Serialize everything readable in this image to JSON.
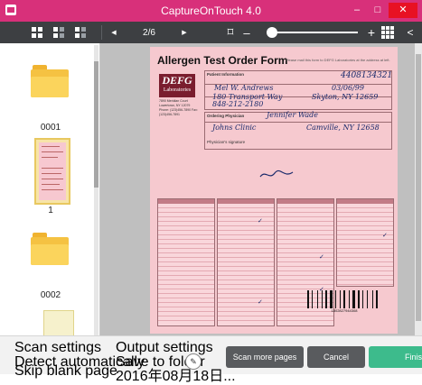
{
  "window": {
    "title": "CaptureOnTouch 4.0",
    "controls": {
      "minimize": "–",
      "maximize": "□",
      "close": "✕"
    }
  },
  "toolbar": {
    "page_indicator": "2/6",
    "prev_icon": "◀",
    "next_icon": "▶",
    "fit_icon": "⌑",
    "zoom_out": "–",
    "zoom_in": "+",
    "collapse_icon": "<",
    "zoom_level_fraction": 0.05
  },
  "thumbnails": [
    {
      "label": "0001",
      "kind": "folder"
    },
    {
      "label": "1",
      "kind": "page",
      "selected": true
    },
    {
      "label": "0002",
      "kind": "folder"
    }
  ],
  "document": {
    "title": "Allergen Test Order Form",
    "note": "Please mail this form to DEFG Laboratories at the address at left.",
    "logo_line1": "DEFG",
    "logo_line2": "Laboratories",
    "address": "7890 Meridian Court Lowertown, NY 12079 Phone: (123)456-7890 Fax: (123)456-7891",
    "patient_info_label": "Patient Information",
    "ordering_physician_label": "Ordering Physician",
    "physician_signature_label": "Physician's signature",
    "handwriting": {
      "id": "4408134321",
      "name": "Mel W. Andrews",
      "dob": "03/06/99",
      "address": "180 Transport Way",
      "city": "Skyton, NY 12659",
      "phone": "848-212-2180",
      "physician": "Jennifer Wade",
      "clinic": "Johns Clinic",
      "phys_city": "Camville, NY 12658"
    },
    "barcode_number": "1802827944308"
  },
  "bottom": {
    "scan_settings_label": "Scan settings",
    "scan_setting_1": "Detect automatically",
    "scan_setting_2": "Skip blank page",
    "output_settings_label": "Output settings",
    "output_setting_1": "Save to folder",
    "output_setting_2": "2016年08月18日...",
    "edit_icon": "✎",
    "scan_more_label": "Scan more pages",
    "cancel_label": "Cancel",
    "finish_label": "Finis"
  },
  "colors": {
    "titlebar": "#d8307a",
    "toolbar": "#3d3f42",
    "finish_button": "#3dbb8c",
    "document_paper": "#f6c9cf"
  }
}
